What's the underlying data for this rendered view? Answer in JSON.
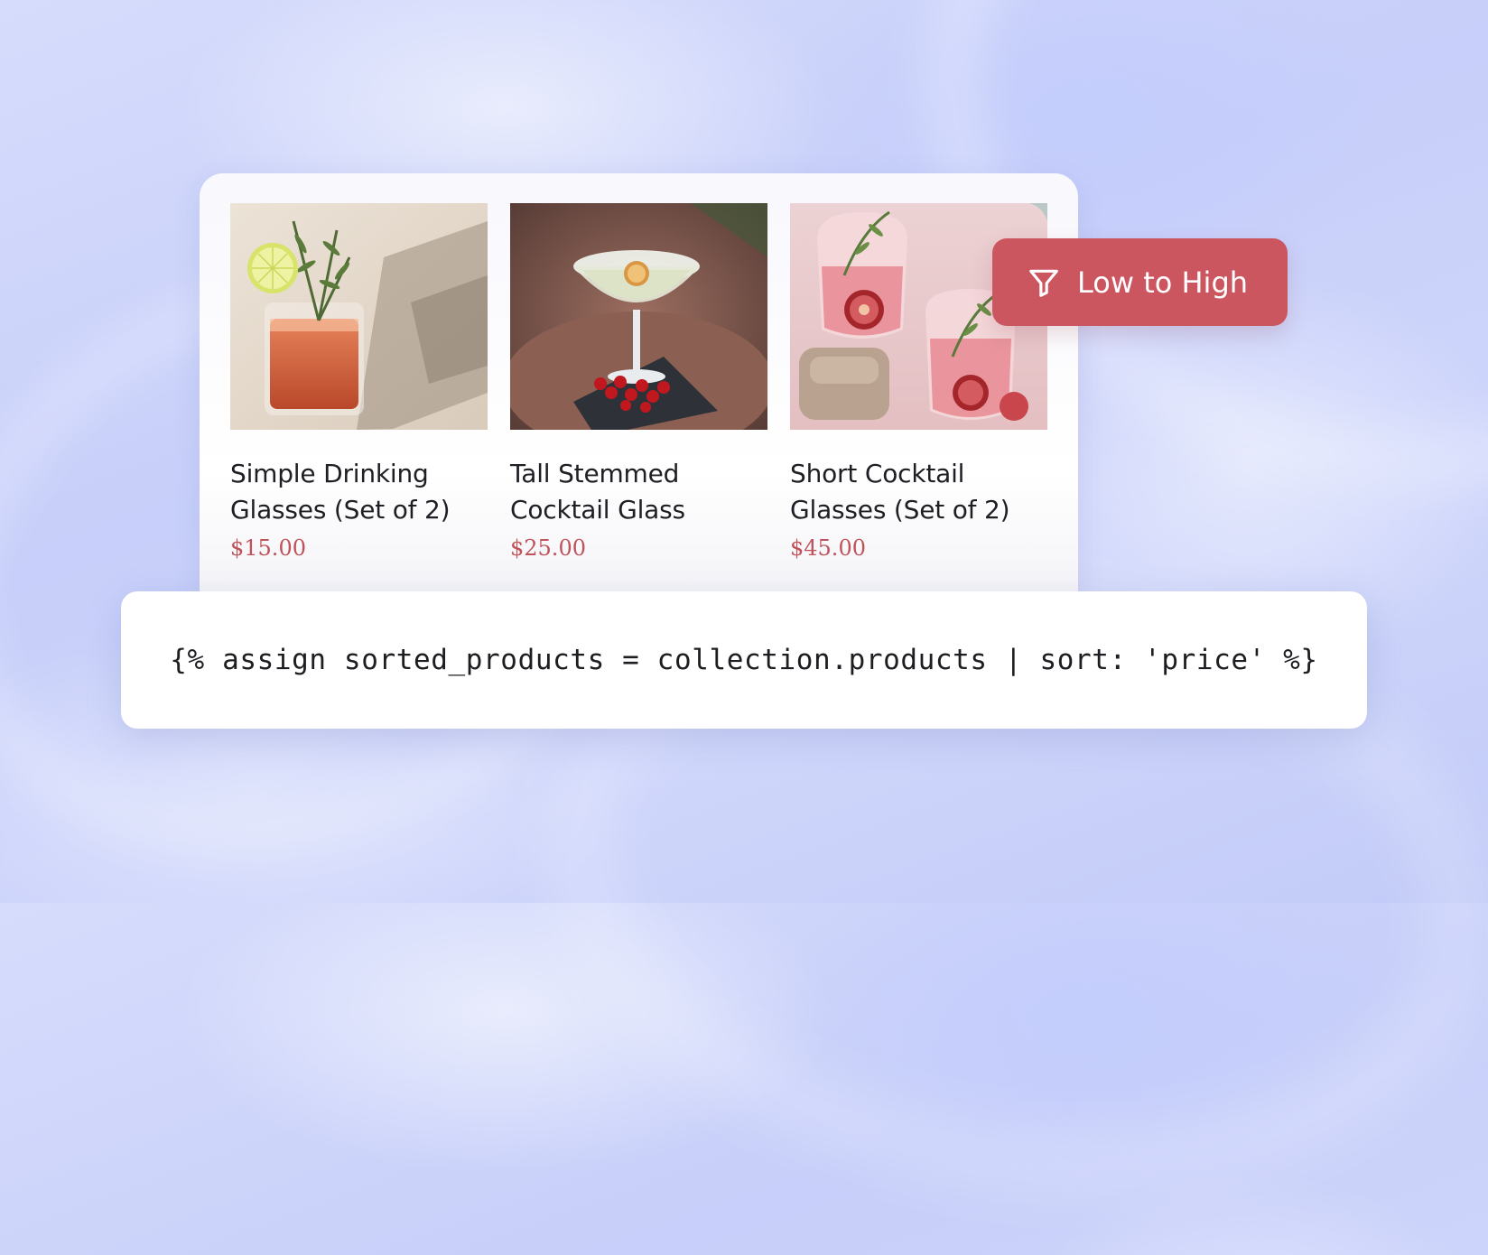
{
  "colors": {
    "accent": "#cc5660",
    "price": "#c0525a",
    "text": "#1e1e24",
    "card_bg": "#ffffff"
  },
  "products": [
    {
      "name_line1": "Simple Drinking",
      "name_line2": "Glasses (Set of 2)",
      "price": "$15.00",
      "image": "drinking-glass-photo"
    },
    {
      "name_line1": "Tall Stemmed",
      "name_line2": "Cocktail Glass",
      "price": "$25.00",
      "image": "stemmed-cocktail-glass-photo"
    },
    {
      "name_line1": "Short Cocktail",
      "name_line2": "Glasses (Set of 2)",
      "price": "$45.00",
      "image": "short-cocktail-glasses-photo"
    }
  ],
  "sort_button": {
    "label": "Low to High",
    "icon": "filter-icon"
  },
  "code": {
    "line": "{% assign sorted_products = collection.products | sort: 'price' %}"
  }
}
